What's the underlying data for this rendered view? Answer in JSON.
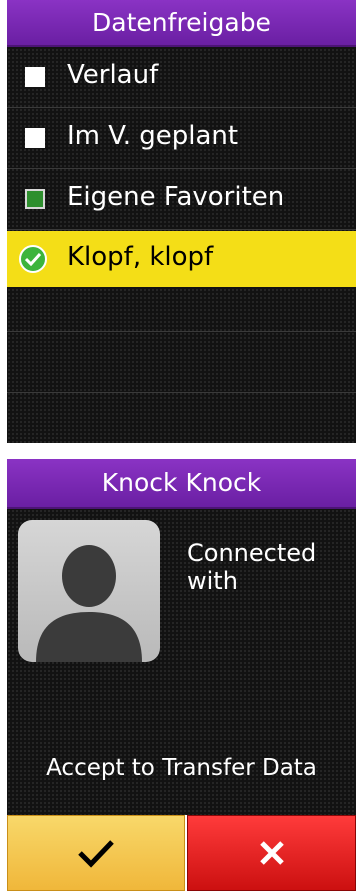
{
  "screen1": {
    "cut_title": "g",
    "title": "Datenfreigabe",
    "items": [
      {
        "label": "Verlauf",
        "state": "unchecked"
      },
      {
        "label": "Im V. geplant",
        "state": "unchecked"
      },
      {
        "label": "Eigene Favoriten",
        "state": "checked"
      },
      {
        "label": "Klopf, klopf",
        "state": "selected"
      }
    ]
  },
  "screen2": {
    "title": "Knock Knock",
    "connected_line1": "Connected",
    "connected_line2": "with",
    "prompt": "Accept to Transfer Data",
    "accept_icon": "checkmark-icon",
    "cancel_icon": "x-icon"
  },
  "colors": {
    "title_bar": "#7b2bbb",
    "highlight": "#f4de17",
    "accept_button": "#f0c04a",
    "cancel_button": "#e02020",
    "check_green": "#3cb43c"
  }
}
